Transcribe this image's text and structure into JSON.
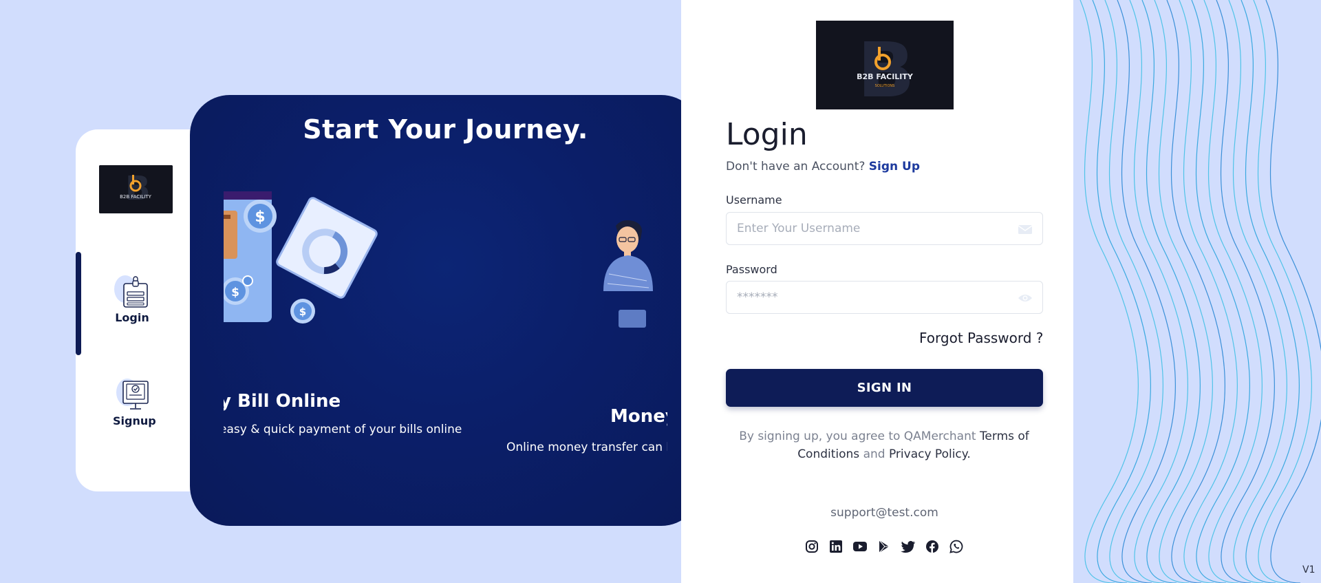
{
  "brand": {
    "logo_text": "B2B FACILITY",
    "logo_subtext": "SOLUTIONS"
  },
  "side_nav": {
    "items": [
      {
        "label": "Login",
        "icon": "lock-form-icon"
      },
      {
        "label": "Signup",
        "icon": "monitor-check-icon"
      }
    ]
  },
  "hero": {
    "title": "Start Your Journey.",
    "slides": [
      {
        "title": "y Bill Online",
        "desc": "easy & quick payment of your bills online"
      },
      {
        "title": "Money",
        "desc": "Online money transfer can b"
      }
    ]
  },
  "login": {
    "title": "Login",
    "signup_prompt": "Don't have an Account?",
    "signup_link": "Sign Up",
    "username_label": "Username",
    "username_placeholder": "Enter Your Username",
    "password_label": "Password",
    "password_placeholder": "*******",
    "forgot": "Forgot Password ?",
    "signin": "SIGN IN",
    "terms_prefix": "By signing up, you agree to QAMerchant",
    "terms_link": "Terms of Conditions",
    "terms_and": "and",
    "privacy_link": "Privacy Policy.",
    "support_email": "support@test.com",
    "socials": [
      "instagram-icon",
      "linkedin-icon",
      "youtube-icon",
      "google-play-icon",
      "twitter-icon",
      "facebook-icon",
      "whatsapp-icon"
    ]
  },
  "version": "V1",
  "colors": {
    "navy": "#0e1c57",
    "hero_bg": "#0b1f6a",
    "page_bg": "#d1ddfd",
    "link": "#1d3a9e"
  }
}
